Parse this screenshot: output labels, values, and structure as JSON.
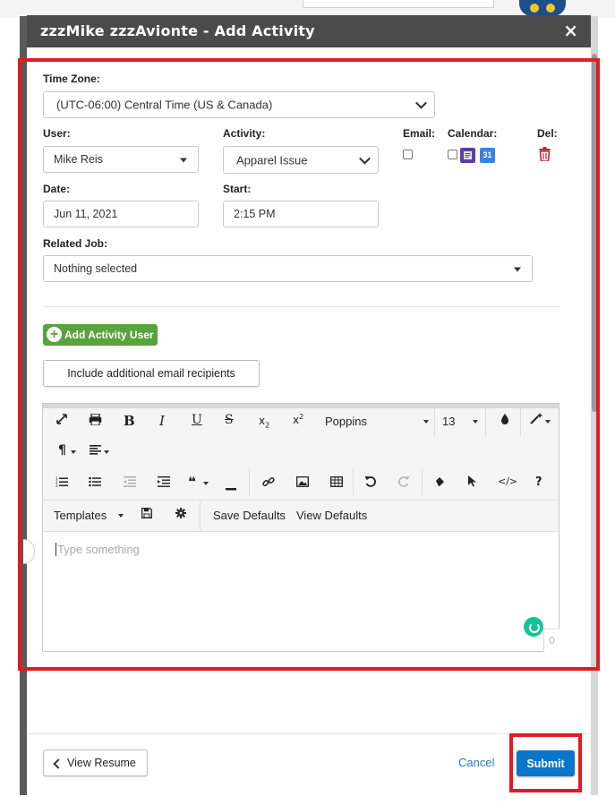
{
  "modal": {
    "title": "zzzMike zzzAvionte - Add Activity",
    "close_symbol": "×"
  },
  "form": {
    "time_zone_label": "Time Zone:",
    "time_zone_value": "(UTC-06:00) Central Time (US & Canada)",
    "user_label": "User:",
    "user_value": "Mike Reis",
    "activity_label": "Activity:",
    "activity_value": "Apparel Issue",
    "email_label": "Email:",
    "calendar_label": "Calendar:",
    "calendar_google_day": "31",
    "del_label": "Del:",
    "date_label": "Date:",
    "date_value": "Jun 11, 2021",
    "start_label": "Start:",
    "start_value": "2:15 PM",
    "related_job_label": "Related Job:",
    "related_job_value": "Nothing selected"
  },
  "buttons": {
    "add_activity_user": "Add Activity User",
    "include_recipients": "Include additional email recipients",
    "view_resume": "View Resume",
    "cancel": "Cancel",
    "submit": "Submit"
  },
  "editor": {
    "font_name": "Poppins",
    "font_size": "13",
    "templates_label": "Templates",
    "save_defaults": "Save Defaults",
    "view_defaults": "View Defaults",
    "placeholder": "Type something",
    "char_count": "0",
    "toolbar_icons": [
      "fullscreen-icon",
      "print-icon",
      "bold-icon",
      "italic-icon",
      "underline-icon",
      "strikethrough-icon",
      "subscript-icon",
      "superscript-icon",
      "font-family-dropdown",
      "font-size-dropdown",
      "color-icon",
      "magic-wand-icon",
      "paragraph-icon",
      "align-icon",
      "ordered-list-icon",
      "unordered-list-icon",
      "outdent-icon",
      "indent-icon",
      "quote-icon",
      "horizontal-rule-icon",
      "link-icon",
      "image-icon",
      "table-icon",
      "undo-icon",
      "redo-icon",
      "eraser-icon",
      "select-icon",
      "code-view-icon",
      "help-icon"
    ]
  },
  "colors": {
    "header_bg": "#4b4b4b",
    "highlight": "#e11b22",
    "add_button": "#5aa23c",
    "submit_button": "#0a76c9",
    "cancel_link": "#2a7bc4",
    "trash": "#c0272d"
  }
}
